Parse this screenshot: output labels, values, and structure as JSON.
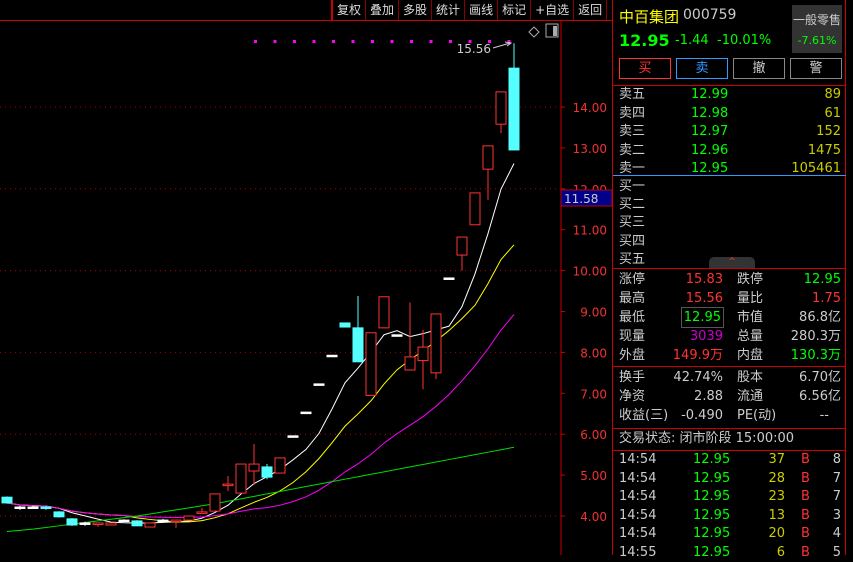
{
  "toolbar": [
    "复权",
    "叠加",
    "多股",
    "统计",
    "画线",
    "标记",
    "+自选",
    "返回"
  ],
  "stock": {
    "name": "中百集团",
    "code": "000759",
    "price": "12.95",
    "change": "-1.44",
    "change_pct": "-10.01%",
    "industry": "一般零售",
    "industry_pct": "-7.61%"
  },
  "actions": {
    "buy": "买",
    "sell": "卖",
    "cancel": "撤",
    "alert": "警"
  },
  "asks": [
    {
      "label": "卖五",
      "price": "12.99",
      "vol": "89"
    },
    {
      "label": "卖四",
      "price": "12.98",
      "vol": "61"
    },
    {
      "label": "卖三",
      "price": "12.97",
      "vol": "152"
    },
    {
      "label": "卖二",
      "price": "12.96",
      "vol": "1475"
    },
    {
      "label": "卖一",
      "price": "12.95",
      "vol": "105461"
    }
  ],
  "bids": [
    {
      "label": "买一"
    },
    {
      "label": "买二"
    },
    {
      "label": "买三"
    },
    {
      "label": "买四"
    },
    {
      "label": "买五"
    }
  ],
  "collapse": "^",
  "stats": [
    {
      "l1": "涨停",
      "v1": "15.83",
      "l2": "跌停",
      "v2": "12.95"
    },
    {
      "l1": "最高",
      "v1": "15.56",
      "l2": "量比",
      "v2": "1.75"
    },
    {
      "l1": "最低",
      "v1": "12.95",
      "l2": "市值",
      "v2": "86.8亿"
    },
    {
      "l1": "现量",
      "v1": "3039",
      "l2": "总量",
      "v2": "280.3万"
    },
    {
      "l1": "外盘",
      "v1": "149.9万",
      "l2": "内盘",
      "v2": "130.3万"
    }
  ],
  "fund": [
    {
      "l1": "换手",
      "v1": "42.74%",
      "l2": "股本",
      "v2": "6.70亿"
    },
    {
      "l1": "净资",
      "v1": "2.88",
      "l2": "流通",
      "v2": "6.56亿"
    },
    {
      "l1": "收益(三)",
      "v1": "-0.490",
      "l2": "PE(动)",
      "v2": "--"
    }
  ],
  "status": "交易状态: 闭市阶段 15:00:00",
  "ticks": [
    {
      "t": "14:54",
      "p": "12.95",
      "v": "37",
      "bs": "B",
      "n": "8"
    },
    {
      "t": "14:54",
      "p": "12.95",
      "v": "28",
      "bs": "B",
      "n": "7"
    },
    {
      "t": "14:54",
      "p": "12.95",
      "v": "23",
      "bs": "B",
      "n": "7"
    },
    {
      "t": "14:54",
      "p": "12.95",
      "v": "13",
      "bs": "B",
      "n": "3"
    },
    {
      "t": "14:54",
      "p": "12.95",
      "v": "20",
      "bs": "B",
      "n": "4"
    },
    {
      "t": "14:55",
      "p": "12.95",
      "v": "6",
      "bs": "B",
      "n": "5"
    }
  ],
  "chart_data": {
    "type": "candlestick",
    "y_ticks": [
      "4.00",
      "5.00",
      "6.00",
      "7.00",
      "8.00",
      "9.00",
      "10.00",
      "11.00",
      "12.00",
      "13.00",
      "14.00"
    ],
    "ylim": [
      3.6,
      15.7
    ],
    "high_label": "15.56",
    "cursor_price": "11.58",
    "colors": {
      "up": "#ff3333",
      "down": "#55ffff",
      "ma5": "#ffffff",
      "ma10": "#ffff00",
      "ma20": "#ff00ff",
      "ma60": "#00dd00"
    },
    "ohlc": [
      [
        4.46,
        4.48,
        4.3,
        4.32
      ],
      [
        4.22,
        4.25,
        4.15,
        4.22
      ],
      [
        4.22,
        4.25,
        4.18,
        4.22
      ],
      [
        4.22,
        4.25,
        4.15,
        4.2
      ],
      [
        4.1,
        4.12,
        3.96,
        3.98
      ],
      [
        3.93,
        3.95,
        3.76,
        3.78
      ],
      [
        3.83,
        3.86,
        3.76,
        3.83
      ],
      [
        3.82,
        3.83,
        3.74,
        3.83
      ],
      [
        3.78,
        3.83,
        3.78,
        3.83
      ],
      [
        3.9,
        3.92,
        3.88,
        3.9
      ],
      [
        3.88,
        3.9,
        3.76,
        3.76
      ],
      [
        3.73,
        3.83,
        3.73,
        3.83
      ],
      [
        3.9,
        3.93,
        3.88,
        3.9
      ],
      [
        3.88,
        3.9,
        3.71,
        3.9
      ],
      [
        3.9,
        4.0,
        3.9,
        4.0
      ],
      [
        4.08,
        4.2,
        4.08,
        4.1
      ],
      [
        4.12,
        4.54,
        4.12,
        4.54
      ],
      [
        4.76,
        4.98,
        4.61,
        4.78
      ],
      [
        4.56,
        5.27,
        4.56,
        5.27
      ],
      [
        5.1,
        5.76,
        4.76,
        5.27
      ],
      [
        5.2,
        5.27,
        4.9,
        4.95
      ],
      [
        5.05,
        5.42,
        5.05,
        5.42
      ],
      [
        5.96,
        5.96,
        5.96,
        5.96
      ],
      [
        6.54,
        6.54,
        6.54,
        6.54
      ],
      [
        7.23,
        7.23,
        7.23,
        7.23
      ],
      [
        7.93,
        7.93,
        7.93,
        7.93
      ],
      [
        8.72,
        8.72,
        8.62,
        8.62
      ],
      [
        8.6,
        9.38,
        7.77,
        7.77
      ],
      [
        6.95,
        8.48,
        6.95,
        8.48
      ],
      [
        8.6,
        9.36,
        8.6,
        9.36
      ],
      [
        8.43,
        8.43,
        8.43,
        8.43
      ],
      [
        7.57,
        9.22,
        7.57,
        7.89
      ],
      [
        7.8,
        8.55,
        7.1,
        8.13
      ],
      [
        7.5,
        8.94,
        7.35,
        8.94
      ],
      [
        9.82,
        9.82,
        9.82,
        9.82
      ],
      [
        10.38,
        10.82,
        10.0,
        10.82
      ],
      [
        11.12,
        11.9,
        11.12,
        11.9
      ],
      [
        12.48,
        13.05,
        11.73,
        13.05
      ],
      [
        13.58,
        14.37,
        13.36,
        14.37
      ],
      [
        14.95,
        15.56,
        12.95,
        12.95
      ]
    ],
    "ma60": [
      3.62,
      3.65,
      3.68,
      3.72,
      3.76,
      3.8,
      3.84,
      3.88,
      3.92,
      3.96,
      4.0,
      4.05,
      4.1,
      4.15,
      4.2,
      4.25,
      4.3,
      4.36,
      4.42,
      4.48,
      4.54,
      4.6,
      4.66,
      4.72,
      4.78,
      4.84,
      4.9,
      4.96,
      5.02,
      5.08,
      5.14,
      5.2,
      5.26,
      5.32,
      5.38,
      5.44,
      5.5,
      5.56,
      5.62,
      5.68
    ]
  }
}
